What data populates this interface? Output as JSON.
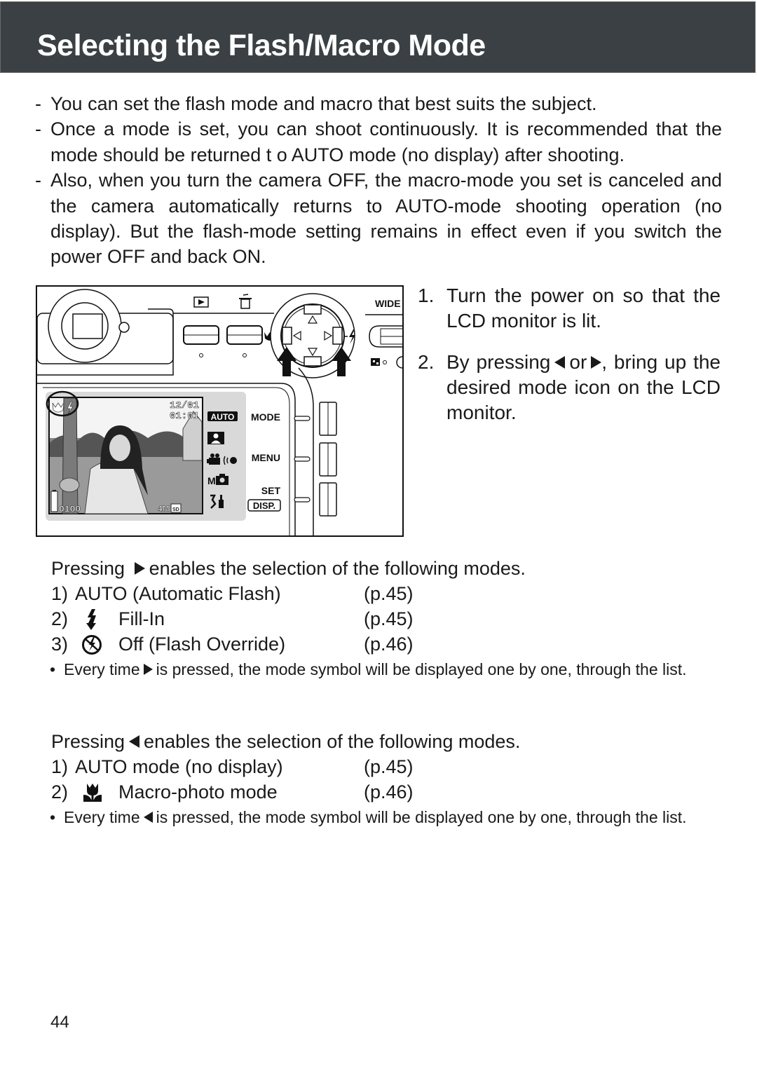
{
  "header": {
    "title": "Selecting the Flash/Macro Mode"
  },
  "intro": {
    "items": [
      {
        "dash": "-",
        "text": "You can set the flash mode and macro that best suits the subject."
      },
      {
        "dash": "-",
        "text": "Once a mode is set, you can shoot continuously. It is recommended that the mode should be returned t o AUTO mode (no display) after shooting."
      },
      {
        "dash": "-",
        "text": "Also, when you turn the camera OFF, the macro-mode you set is canceled and the camera automatically returns to AUTO-mode shooting operation (no display). But  the flash-mode setting remains in effect even if you switch the power OFF and back ON."
      }
    ]
  },
  "figure": {
    "top_panel": {
      "zoom_label": "WIDE",
      "play_icon": "playback-icon",
      "delete_icon": "trash-icon",
      "macro_icon": "macro-tulip-icon",
      "flash_icon": "flash-icon",
      "quality_icon": "checker-icon"
    },
    "lcd": {
      "date": "12/01",
      "time": "01:01",
      "frame_count": "0100",
      "resolution": "4M",
      "card": "SD",
      "menu_icons": [
        "AUTO",
        "portrait-icon",
        "movie-icon",
        "voice-icon",
        "M",
        "camera-icon",
        "setup-icon"
      ]
    },
    "side_buttons": [
      {
        "label": "MODE"
      },
      {
        "label": "MENU"
      },
      {
        "label": "SET",
        "sub": "DISP."
      }
    ]
  },
  "steps": [
    {
      "num": "1.",
      "text": "Turn the power on so that the LCD monitor is lit."
    },
    {
      "num": "2.",
      "text_before": "By pressing",
      "text_mid": "or",
      "text_after": ", bring up the desired  mode icon on the LCD monitor."
    }
  ],
  "right_section": {
    "lead_before": "Pressing",
    "lead_after": "enables the selection of the following modes.",
    "modes": [
      {
        "num": "1)",
        "icon": "",
        "label": "AUTO (Automatic Flash)",
        "page": "(p.45)"
      },
      {
        "num": "2)",
        "icon": "flash-fill-in-icon",
        "label": "Fill-In",
        "page": "(p.45)"
      },
      {
        "num": "3)",
        "icon": "flash-off-icon",
        "label": "Off (Flash Override)",
        "page": "(p.46)"
      }
    ],
    "note_bullet": "•",
    "note_before": "Every time",
    "note_after": "is pressed, the mode symbol will be displayed one by one, through the list."
  },
  "left_section": {
    "lead_before": "Pressing",
    "lead_after": "enables the selection of the following modes.",
    "modes": [
      {
        "num": "1)",
        "icon": "",
        "label": "AUTO mode (no display)",
        "page": "(p.45)"
      },
      {
        "num": "2)",
        "icon": "macro-icon",
        "label": "Macro-photo mode",
        "page": "(p.46)"
      }
    ],
    "note_bullet": "•",
    "note_before": "Every time",
    "note_after": "is pressed, the mode symbol will be displayed one by one, through the list."
  },
  "footer": {
    "page_number": "44"
  },
  "colors": {
    "header_bg": "#3a4043",
    "header_text": "#ffffff",
    "text": "#1a1a1a",
    "lcd_panel": "#d9d9d9"
  }
}
